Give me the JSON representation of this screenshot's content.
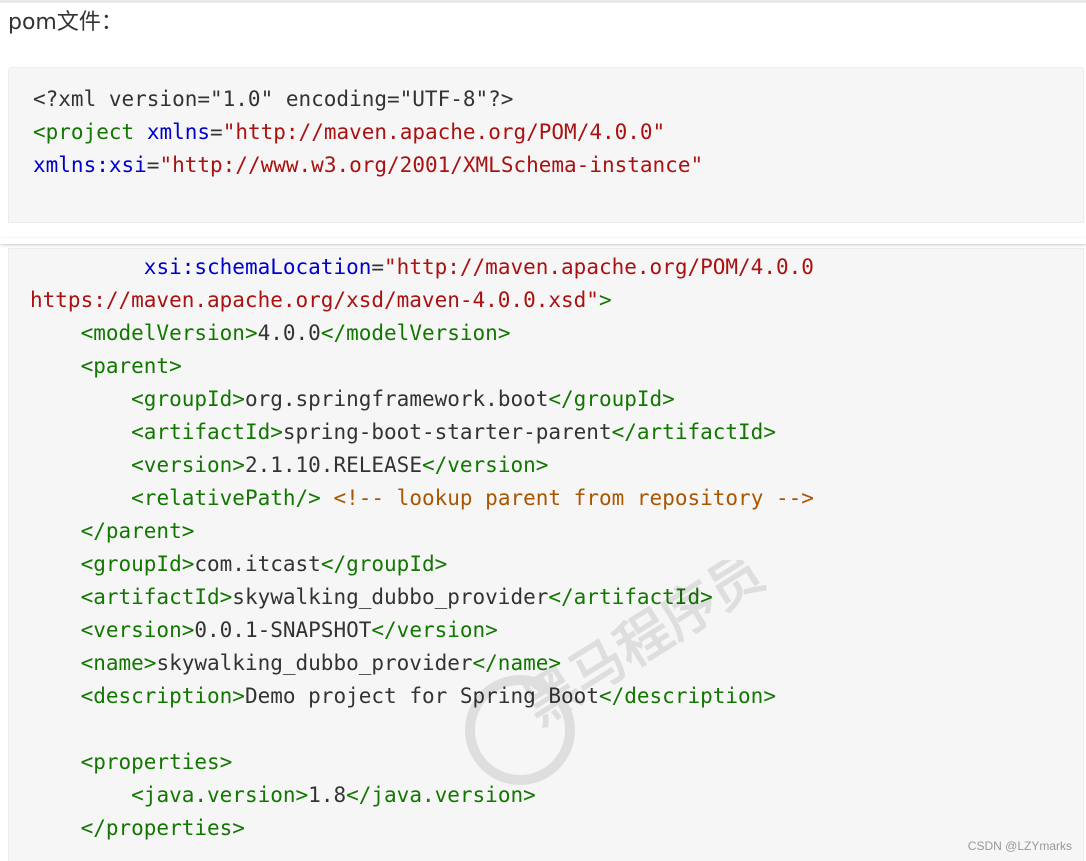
{
  "heading": "pom文件：",
  "block_a_lines": [
    [
      {
        "t": "<?xml version=\"1.0\" encoding=\"UTF-8\"?>",
        "c": "plain"
      }
    ],
    [
      {
        "t": "<project",
        "c": "tag"
      },
      {
        "t": " ",
        "c": "plain"
      },
      {
        "t": "xmlns",
        "c": "attr"
      },
      {
        "t": "=",
        "c": "plain"
      },
      {
        "t": "\"http://maven.apache.org/POM/4.0.0\"",
        "c": "str"
      }
    ],
    [
      {
        "t": "xmlns:xsi",
        "c": "attr"
      },
      {
        "t": "=",
        "c": "plain"
      },
      {
        "t": "\"http://www.w3.org/2001/XMLSchema-instance\"",
        "c": "str"
      }
    ]
  ],
  "block_b_lines": [
    [
      {
        "t": "         ",
        "c": "plain"
      },
      {
        "t": "xsi:schemaLocation",
        "c": "attr"
      },
      {
        "t": "=",
        "c": "plain"
      },
      {
        "t": "\"http://maven.apache.org/POM/4.0.0",
        "c": "str"
      }
    ],
    [
      {
        "t": "https://maven.apache.org/xsd/maven-4.0.0.xsd\"",
        "c": "str"
      },
      {
        "t": ">",
        "c": "tag"
      }
    ],
    [
      {
        "t": "    ",
        "c": "plain"
      },
      {
        "t": "<modelVersion>",
        "c": "tag"
      },
      {
        "t": "4.0.0",
        "c": "plain"
      },
      {
        "t": "</modelVersion>",
        "c": "tag"
      }
    ],
    [
      {
        "t": "    ",
        "c": "plain"
      },
      {
        "t": "<parent>",
        "c": "tag"
      }
    ],
    [
      {
        "t": "        ",
        "c": "plain"
      },
      {
        "t": "<groupId>",
        "c": "tag"
      },
      {
        "t": "org.springframework.boot",
        "c": "plain"
      },
      {
        "t": "</groupId>",
        "c": "tag"
      }
    ],
    [
      {
        "t": "        ",
        "c": "plain"
      },
      {
        "t": "<artifactId>",
        "c": "tag"
      },
      {
        "t": "spring-boot-starter-parent",
        "c": "plain"
      },
      {
        "t": "</artifactId>",
        "c": "tag"
      }
    ],
    [
      {
        "t": "        ",
        "c": "plain"
      },
      {
        "t": "<version>",
        "c": "tag"
      },
      {
        "t": "2.1.10.RELEASE",
        "c": "plain"
      },
      {
        "t": "</version>",
        "c": "tag"
      }
    ],
    [
      {
        "t": "        ",
        "c": "plain"
      },
      {
        "t": "<relativePath/>",
        "c": "tag"
      },
      {
        "t": " ",
        "c": "plain"
      },
      {
        "t": "<!-- lookup parent from repository -->",
        "c": "comment"
      }
    ],
    [
      {
        "t": "    ",
        "c": "plain"
      },
      {
        "t": "</parent>",
        "c": "tag"
      }
    ],
    [
      {
        "t": "    ",
        "c": "plain"
      },
      {
        "t": "<groupId>",
        "c": "tag"
      },
      {
        "t": "com.itcast",
        "c": "plain"
      },
      {
        "t": "</groupId>",
        "c": "tag"
      }
    ],
    [
      {
        "t": "    ",
        "c": "plain"
      },
      {
        "t": "<artifactId>",
        "c": "tag"
      },
      {
        "t": "skywalking_dubbo_provider",
        "c": "plain"
      },
      {
        "t": "</artifactId>",
        "c": "tag"
      }
    ],
    [
      {
        "t": "    ",
        "c": "plain"
      },
      {
        "t": "<version>",
        "c": "tag"
      },
      {
        "t": "0.0.1-SNAPSHOT",
        "c": "plain"
      },
      {
        "t": "</version>",
        "c": "tag"
      }
    ],
    [
      {
        "t": "    ",
        "c": "plain"
      },
      {
        "t": "<name>",
        "c": "tag"
      },
      {
        "t": "skywalking_dubbo_provider",
        "c": "plain"
      },
      {
        "t": "</name>",
        "c": "tag"
      }
    ],
    [
      {
        "t": "    ",
        "c": "plain"
      },
      {
        "t": "<description>",
        "c": "tag"
      },
      {
        "t": "Demo project for Spring Boot",
        "c": "plain"
      },
      {
        "t": "</description>",
        "c": "tag"
      }
    ],
    [
      {
        "t": "",
        "c": "plain"
      }
    ],
    [
      {
        "t": "    ",
        "c": "plain"
      },
      {
        "t": "<properties>",
        "c": "tag"
      }
    ],
    [
      {
        "t": "        ",
        "c": "plain"
      },
      {
        "t": "<java.version>",
        "c": "tag"
      },
      {
        "t": "1.8",
        "c": "plain"
      },
      {
        "t": "</java.version>",
        "c": "tag"
      }
    ],
    [
      {
        "t": "    ",
        "c": "plain"
      },
      {
        "t": "</properties>",
        "c": "tag"
      }
    ]
  ],
  "watermark_text": "黑马程序员",
  "credit": "CSDN @LZYmarks",
  "colors": {
    "tag": "#117700",
    "attr": "#0000cc",
    "str": "#aa1111",
    "comment": "#aa5500",
    "plain": "#333333",
    "code_bg": "#f6f6f6"
  }
}
